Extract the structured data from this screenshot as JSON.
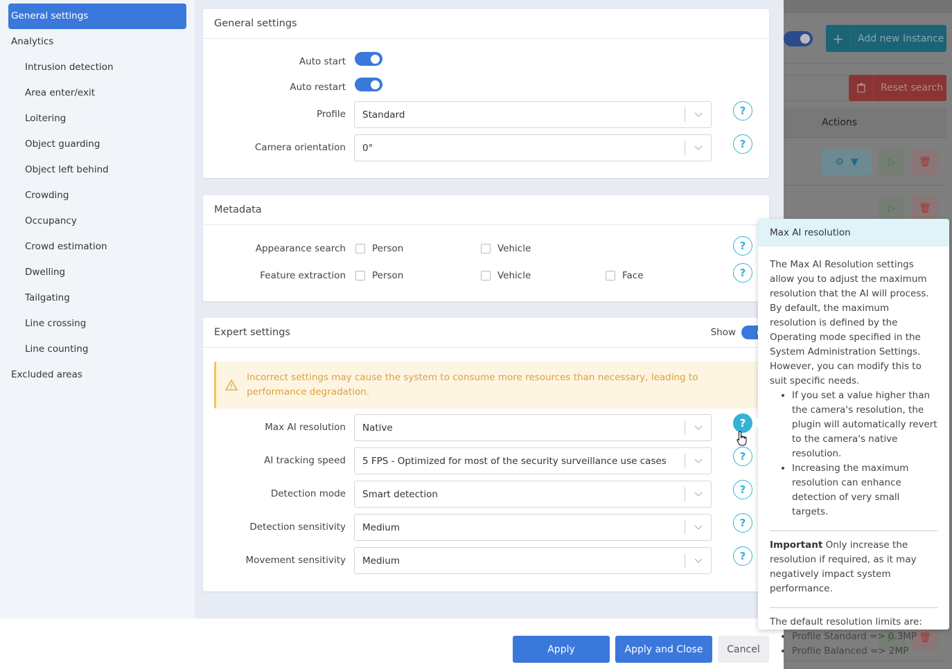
{
  "sidebar": {
    "items": [
      {
        "label": "General settings",
        "level": "top",
        "active": true
      },
      {
        "label": "Analytics",
        "level": "top"
      },
      {
        "label": "Intrusion detection",
        "level": "sub"
      },
      {
        "label": "Area enter/exit",
        "level": "sub"
      },
      {
        "label": "Loitering",
        "level": "sub"
      },
      {
        "label": "Object guarding",
        "level": "sub"
      },
      {
        "label": "Object left behind",
        "level": "sub"
      },
      {
        "label": "Crowding",
        "level": "sub"
      },
      {
        "label": "Occupancy",
        "level": "sub"
      },
      {
        "label": "Crowd estimation",
        "level": "sub"
      },
      {
        "label": "Dwelling",
        "level": "sub"
      },
      {
        "label": "Tailgating",
        "level": "sub"
      },
      {
        "label": "Line crossing",
        "level": "sub"
      },
      {
        "label": "Line counting",
        "level": "sub"
      },
      {
        "label": "Excluded areas",
        "level": "top"
      }
    ]
  },
  "general": {
    "title": "General settings",
    "auto_start_label": "Auto start",
    "auto_start": true,
    "auto_restart_label": "Auto restart",
    "auto_restart": true,
    "profile_label": "Profile",
    "profile_value": "Standard",
    "orientation_label": "Camera orientation",
    "orientation_value": "0°"
  },
  "metadata": {
    "title": "Metadata",
    "appearance_label": "Appearance search",
    "feature_label": "Feature extraction",
    "opt_person": "Person",
    "opt_vehicle": "Vehicle",
    "opt_face": "Face"
  },
  "expert": {
    "title": "Expert settings",
    "show_label": "Show",
    "show": true,
    "warning": "Incorrect settings may cause the system to consume more resources than necessary, leading to performance degradation.",
    "fields": [
      {
        "label": "Max AI resolution",
        "value": "Native"
      },
      {
        "label": "AI tracking speed",
        "value": "5 FPS - Optimized for most of the security surveillance use cases"
      },
      {
        "label": "Detection mode",
        "value": "Smart detection"
      },
      {
        "label": "Detection sensitivity",
        "value": "Medium"
      },
      {
        "label": "Movement sensitivity",
        "value": "Medium"
      }
    ]
  },
  "footer": {
    "apply": "Apply",
    "apply_close": "Apply and Close",
    "cancel": "Cancel"
  },
  "popover": {
    "title": "Max AI resolution",
    "intro": "The Max AI Resolution settings allow you to adjust the maximum resolution that the AI will process. By default, the maximum resolution is defined by the Operating mode specified in the System Administration Settings. However, you can modify this to suit specific needs.",
    "bullets": [
      "If you set a value higher than the camera's resolution, the plugin will automatically revert to the camera's native resolution.",
      "Increasing the maximum resolution can enhance detection of very small targets."
    ],
    "important_label": "Important",
    "important_text": " Only increase the resolution if required, as it may negatively impact system performance.",
    "limits_intro": "The default resolution limits are:",
    "limits": [
      "Profile Standard => 0.3MP",
      "Profile Balanced => 2MP"
    ]
  },
  "background": {
    "add_instance": "Add new Instance",
    "reset_search": "Reset search",
    "actions_header": "Actions"
  },
  "colors": {
    "primary": "#3b78dc",
    "help": "#35b2d6",
    "warning_text": "#d9a33c",
    "warning_bg": "#fef4e2"
  }
}
